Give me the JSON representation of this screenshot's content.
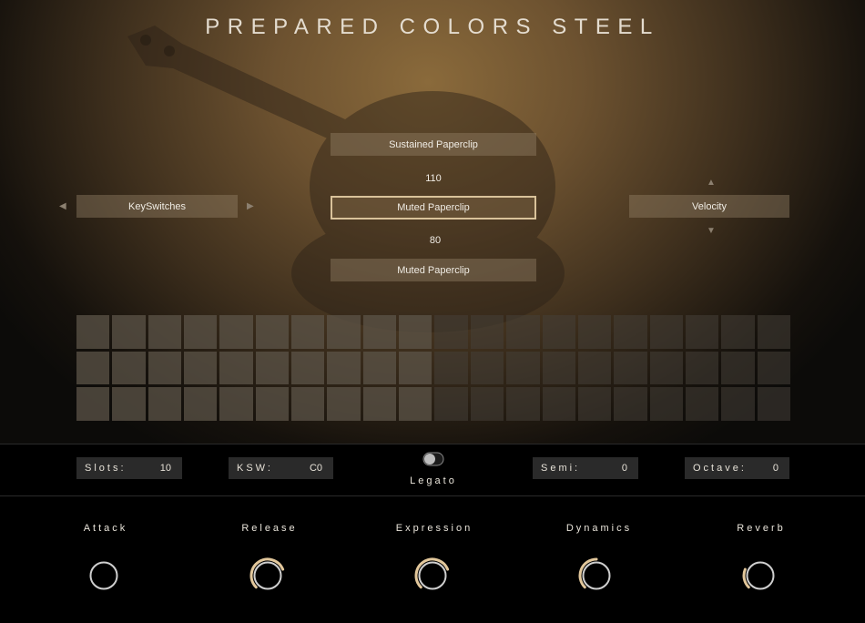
{
  "title": "PREPARED COLORS STEEL",
  "center_stack": {
    "top_button": "Sustained Paperclip",
    "top_value": "110",
    "selected_button": "Muted Paperclip",
    "bottom_value": "80",
    "bottom_button": "Muted Paperclip"
  },
  "left_selector": {
    "label": "KeySwitches"
  },
  "right_selector": {
    "label": "Velocity"
  },
  "slot_grid": {
    "rows": 3,
    "columns": 20,
    "highlighted_columns": 10,
    "active_cell": {
      "row": 2,
      "column": 1
    }
  },
  "footer": {
    "slots": {
      "label": "Slots:",
      "value": "10"
    },
    "ksw": {
      "label": "KSW:",
      "value": "C0"
    },
    "legato": {
      "label": "Legato"
    },
    "semi": {
      "label": "Semi:",
      "value": "0"
    },
    "octave": {
      "label": "Octave:",
      "value": "0"
    }
  },
  "knobs": [
    {
      "label": "Attack",
      "value": 0.0
    },
    {
      "label": "Release",
      "value": 0.75
    },
    {
      "label": "Expression",
      "value": 0.75
    },
    {
      "label": "Dynamics",
      "value": 0.5
    },
    {
      "label": "Reverb",
      "value": 0.25
    }
  ],
  "colors": {
    "accent": "#e2c79b",
    "panel": "#2a2a2a",
    "text": "#e9e4da"
  }
}
